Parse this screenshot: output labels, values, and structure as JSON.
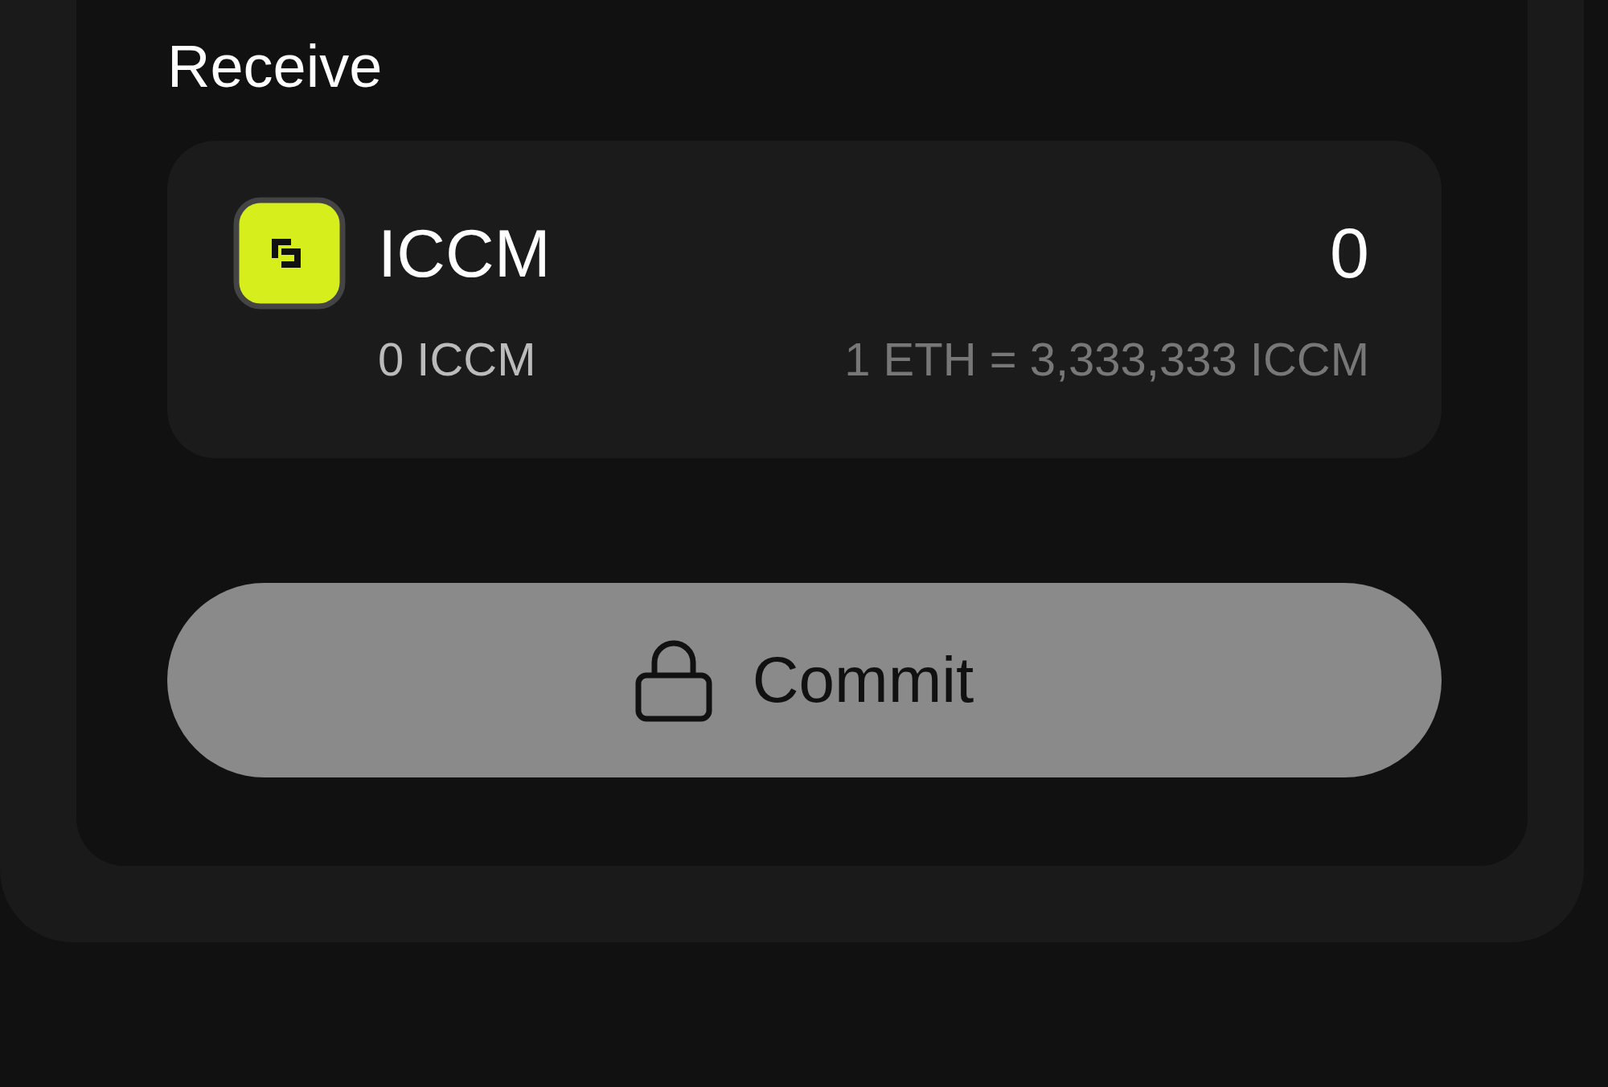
{
  "section_title": "Receive",
  "token": {
    "symbol": "ICCM",
    "amount": "0",
    "balance": "0 ICCM",
    "rate": "1 ETH = 3,333,333 ICCM"
  },
  "button": {
    "label": "Commit",
    "disabled": true
  }
}
